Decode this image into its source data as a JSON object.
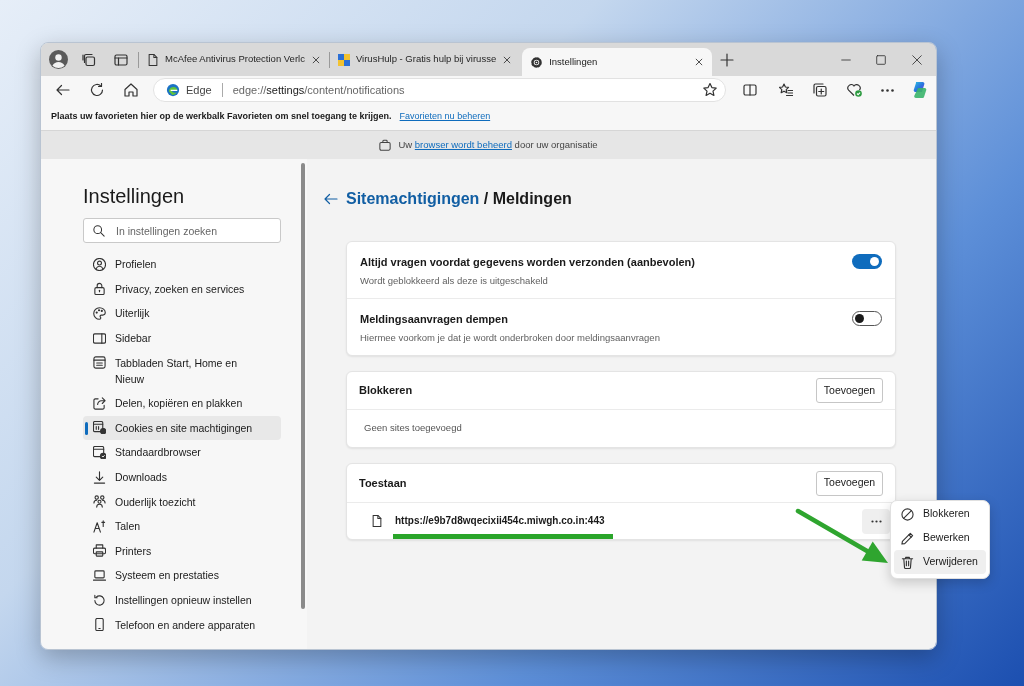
{
  "tab_strip": {
    "tabs": [
      {
        "kind": "page",
        "title": "McAfee Antivirus Protection Verlc",
        "selected": false
      },
      {
        "kind": "site",
        "title": "VirusHulp - Gratis hulp bij virusse",
        "selected": false
      },
      {
        "kind": "settings",
        "title": "Instellingen",
        "selected": true
      }
    ]
  },
  "address_bar": {
    "badge": "Edge",
    "url": "edge://**settings**/content/notifications"
  },
  "favorites_bar": {
    "message": "Plaats uw favorieten hier op de werkbalk Favorieten om snel toegang te krijgen.",
    "link": "Favorieten nu beheren"
  },
  "managed_banner": {
    "before": "Uw",
    "link": "browser wordt beheerd",
    "after": "door uw organisatie"
  },
  "sidebar": {
    "title": "Instellingen",
    "search": {
      "placeholder": "In instellingen zoeken"
    },
    "items": [
      {
        "label": "Profielen",
        "selected": false
      },
      {
        "label": "Privacy, zoeken en services",
        "selected": false
      },
      {
        "label": "Uiterlijk",
        "selected": false
      },
      {
        "label": "Sidebar",
        "selected": false
      },
      {
        "label": "Tabbladen Start, Home en Nieuw",
        "selected": false
      },
      {
        "label": "Delen, kopiëren en plakken",
        "selected": false
      },
      {
        "label": "Cookies en site machtigingen",
        "selected": true
      },
      {
        "label": "Standaardbrowser",
        "selected": false
      },
      {
        "label": "Downloads",
        "selected": false
      },
      {
        "label": "Ouderlijk toezicht",
        "selected": false
      },
      {
        "label": "Talen",
        "selected": false
      },
      {
        "label": "Printers",
        "selected": false
      },
      {
        "label": "Systeem en prestaties",
        "selected": false
      },
      {
        "label": "Instellingen opnieuw instellen",
        "selected": false
      },
      {
        "label": "Telefoon en andere apparaten",
        "selected": false
      }
    ]
  },
  "heading": {
    "link": "Sitemachtigingen",
    "current": "/ Meldingen"
  },
  "settings_card": {
    "rows": [
      {
        "title": "Altijd vragen voordat gegevens worden verzonden (aanbevolen)",
        "description": "Wordt geblokkeerd als deze is uitgeschakeld",
        "on": true
      },
      {
        "title": "Meldingsaanvragen dempen",
        "description": "Hiermee voorkom je dat je wordt onderbroken door meldingsaanvragen",
        "on": false
      }
    ]
  },
  "block_list": {
    "title": "Blokkeren",
    "add_button": "Toevoegen",
    "empty_text": "Geen sites toegevoegd"
  },
  "allow_list": {
    "title": "Toestaan",
    "add_button": "Toevoegen",
    "sites": [
      {
        "url": "https://e9b7d8wqecixii454c.miwgh.co.in:443",
        "highlighted": true
      }
    ]
  },
  "context_menu": {
    "items": [
      {
        "label": "Blokkeren",
        "highlighted": false
      },
      {
        "label": "Bewerken",
        "highlighted": false
      },
      {
        "label": "Verwijderen",
        "highlighted": true
      }
    ]
  }
}
